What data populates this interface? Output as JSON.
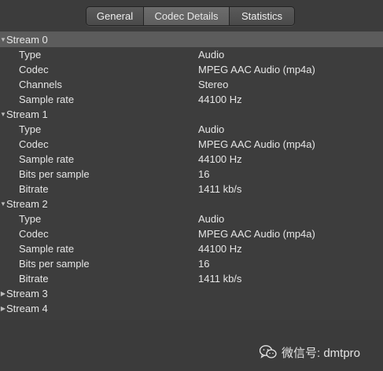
{
  "tabs": [
    {
      "label": "General"
    },
    {
      "label": "Codec Details"
    },
    {
      "label": "Statistics"
    }
  ],
  "streams": [
    {
      "title": "Stream 0",
      "expanded": true,
      "props": [
        {
          "key": "Type",
          "value": "Audio"
        },
        {
          "key": "Codec",
          "value": "MPEG AAC Audio (mp4a)"
        },
        {
          "key": "Channels",
          "value": "Stereo"
        },
        {
          "key": "Sample rate",
          "value": "44100 Hz"
        }
      ]
    },
    {
      "title": "Stream 1",
      "expanded": true,
      "props": [
        {
          "key": "Type",
          "value": "Audio"
        },
        {
          "key": "Codec",
          "value": "MPEG AAC Audio (mp4a)"
        },
        {
          "key": "Sample rate",
          "value": "44100 Hz"
        },
        {
          "key": "Bits per sample",
          "value": "16"
        },
        {
          "key": "Bitrate",
          "value": "1411 kb/s"
        }
      ]
    },
    {
      "title": "Stream 2",
      "expanded": true,
      "props": [
        {
          "key": "Type",
          "value": "Audio"
        },
        {
          "key": "Codec",
          "value": "MPEG AAC Audio (mp4a)"
        },
        {
          "key": "Sample rate",
          "value": "44100 Hz"
        },
        {
          "key": "Bits per sample",
          "value": "16"
        },
        {
          "key": "Bitrate",
          "value": "1411 kb/s"
        }
      ]
    },
    {
      "title": "Stream 3",
      "expanded": false,
      "props": []
    },
    {
      "title": "Stream 4",
      "expanded": false,
      "props": []
    }
  ],
  "watermark": {
    "text": "微信号: dmtpro",
    "icon": "wechat-icon"
  },
  "colors": {
    "background": "#3d3d3d",
    "selected_row": "#5c5c5c",
    "text": "#e6e6e6"
  }
}
